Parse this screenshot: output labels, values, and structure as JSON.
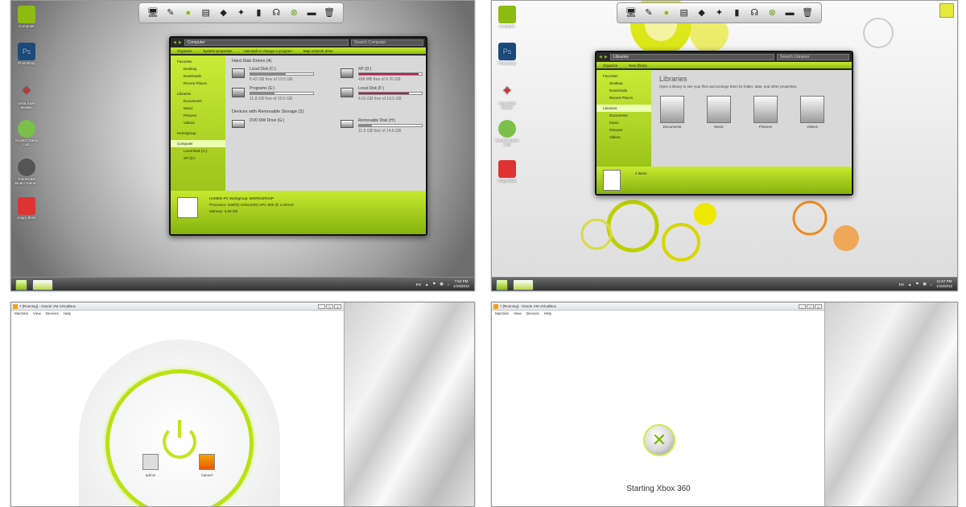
{
  "shot1": {
    "addr": "Computer",
    "search": "Search Computer",
    "cmd": [
      "Organize",
      "System properties",
      "Uninstall or change a program",
      "Map network drive"
    ],
    "nav": [
      "Favorites",
      "Desktop",
      "Downloads",
      "Recent Places",
      "Libraries",
      "Documents",
      "Music",
      "Pictures",
      "Videos",
      "Homegroup",
      "Computer",
      "Local Disk (C:)",
      "XP (D:)"
    ],
    "hdd_group": "Hard Disk Drives (4)",
    "drives": [
      {
        "name": "Local Disk (C:)",
        "free": "8.42 GB free of 19.5 GB",
        "fill": 0.57
      },
      {
        "name": "XP (D:)",
        "free": "498 MB free of 9.76 GB",
        "fill": 0.95
      },
      {
        "name": "Programs (E:)",
        "free": "11.8 GB free of 19.5 GB",
        "fill": 0.39
      },
      {
        "name": "Local Disk (F:)",
        "free": "4.01 GB free of 19.5 GB",
        "fill": 0.79
      }
    ],
    "rem_group": "Devices with Removable Storage (2)",
    "removable": [
      {
        "name": "DVD RW Drive (G:)",
        "free": ""
      },
      {
        "name": "Removable Disk (H:)",
        "free": "11.5 GB free of 14.6 GB",
        "fill": 0.21
      }
    ],
    "details": {
      "line1": "HAMED-PC  Workgroup: WORKGROUP",
      "line2": "Processor: Intel(R) Celeron(R) CPU      900  @ 2.20GHz",
      "line3": "Memory: 3.00 GB"
    },
    "desktop_icons": [
      "Computer",
      "Photoshop",
      "Vista Style Builder",
      "Scratch Game Lab",
      "Gamecube Studio Game...",
      "Angry Birds"
    ],
    "lang": "EN",
    "time": "7:52 PM",
    "date": "1/16/2012"
  },
  "shot2": {
    "addr": "Libraries",
    "search": "Search Libraries",
    "cmd": [
      "Organize",
      "New library"
    ],
    "nav": [
      "Favorites",
      "Desktop",
      "Downloads",
      "Recent Places",
      "Libraries",
      "Documents",
      "Music",
      "Pictures",
      "Videos"
    ],
    "title": "Libraries",
    "subtitle": "Open a library to see your files and arrange them by folder, date, and other properties.",
    "libraries": [
      "Documents",
      "Music",
      "Pictures",
      "Videos"
    ],
    "count": "4 items",
    "desktop_icons": [
      "Computer",
      "Photoshop",
      "Vista Style Builder",
      "Scratch Game Lab",
      "Angry Birds"
    ],
    "lang": "EN",
    "time": "11:57 PM",
    "date": "1/16/2012"
  },
  "shot3": {
    "title": "7 [Running] - Oracle VM VirtualBox",
    "menu": [
      "Machine",
      "View",
      "Devices",
      "Help"
    ],
    "users": [
      "admin",
      "hamed"
    ]
  },
  "shot4": {
    "title": "7 [Running] - Oracle VM VirtualBox",
    "menu": [
      "Machine",
      "View",
      "Devices",
      "Help"
    ],
    "status": "Starting Xbox 360"
  },
  "colors": {
    "accent": "#9cc41a",
    "dark": "#2a2a2a"
  }
}
